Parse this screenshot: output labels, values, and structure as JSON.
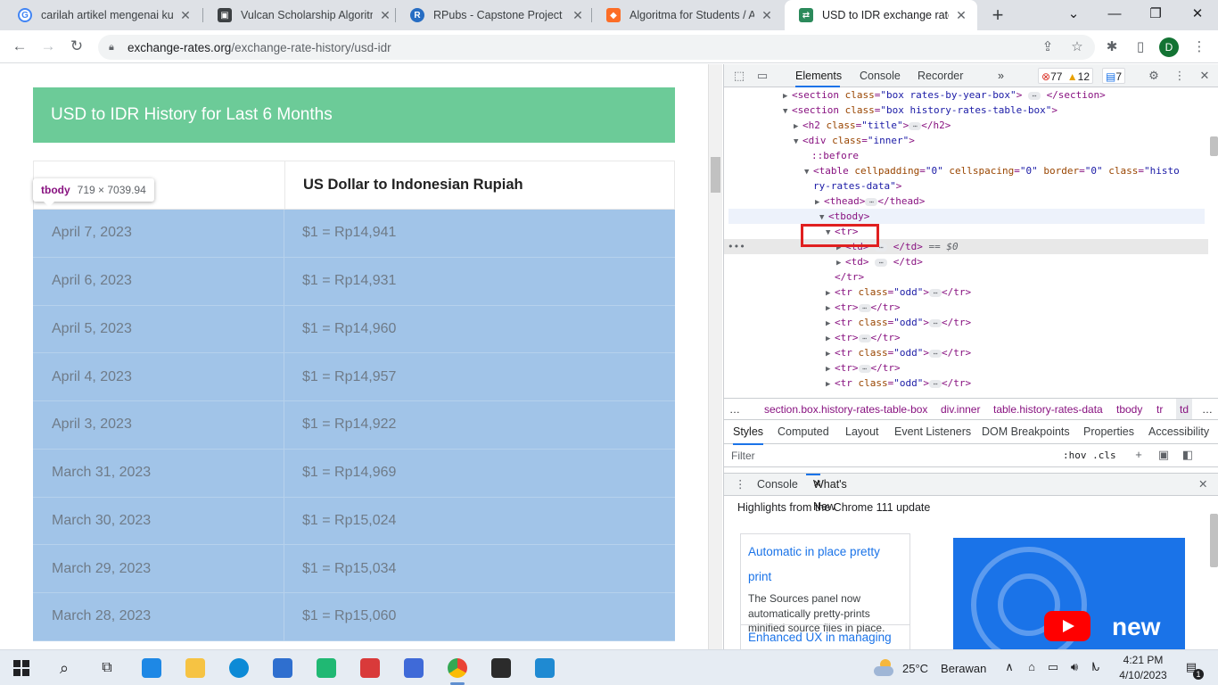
{
  "browser": {
    "tabs": [
      {
        "title": "carilah artikel mengenai kurs",
        "icon": "google-icon"
      },
      {
        "title": "Vulcan Scholarship Algoritma",
        "icon": "portrait-icon"
      },
      {
        "title": "RPubs - Capstone Project Dat",
        "icon": "rpubs-icon"
      },
      {
        "title": "Algoritma for Students / Aca",
        "icon": "gitlab-icon"
      },
      {
        "title": "USD to IDR exchange rate his",
        "icon": "exchange-rates-icon"
      }
    ],
    "url_host": "exchange-rates.org",
    "url_path": "/exchange-rate-history/usd-idr",
    "profile_initial": "D"
  },
  "page": {
    "banner_title": "USD to IDR History for Last 6 Months",
    "table_header": "US Dollar to Indonesian Rupiah",
    "rows": [
      {
        "date": "April 7, 2023",
        "rate": "$1 = Rp14,941"
      },
      {
        "date": "April 6, 2023",
        "rate": "$1 = Rp14,931"
      },
      {
        "date": "April 5, 2023",
        "rate": "$1 = Rp14,960"
      },
      {
        "date": "April 4, 2023",
        "rate": "$1 = Rp14,957"
      },
      {
        "date": "April 3, 2023",
        "rate": "$1 = Rp14,922"
      },
      {
        "date": "March 31, 2023",
        "rate": "$1 = Rp14,969"
      },
      {
        "date": "March 30, 2023",
        "rate": "$1 = Rp15,024"
      },
      {
        "date": "March 29, 2023",
        "rate": "$1 = Rp15,034"
      },
      {
        "date": "March 28, 2023",
        "rate": "$1 = Rp15,060"
      }
    ],
    "tooltip_tag": "tbody",
    "tooltip_dims": "719 × 7039.94"
  },
  "devtools": {
    "tabs": [
      "Elements",
      "Console",
      "Recorder",
      "»"
    ],
    "errors": "77",
    "warnings": "12",
    "messages": "7",
    "crumbs": [
      "section.box.history-rates-table-box",
      "div.inner",
      "table.history-rates-data",
      "tbody",
      "tr",
      "td"
    ],
    "styles_tabs": [
      "Styles",
      "Computed",
      "Layout",
      "Event Listeners",
      "DOM Breakpoints",
      "Properties",
      "Accessibility"
    ],
    "filter_placeholder": "Filter",
    "hov_cls": ":hov  .cls",
    "drawer_tabs": [
      "Console",
      "What's New"
    ],
    "whats_new_heading": "Highlights from the Chrome 111 update",
    "card1_title_line1": "Automatic in place pretty",
    "card1_title_line2": "print",
    "card1_desc": "The Sources panel now automatically pretty-prints minified source files in place.",
    "card2_title": "Enhanced UX in managing",
    "promo_word": "new"
  },
  "taskbar": {
    "temperature": "25°C",
    "weather": "Berawan",
    "time": "4:21 PM",
    "date": "4/10/2023",
    "notifications": "1"
  }
}
